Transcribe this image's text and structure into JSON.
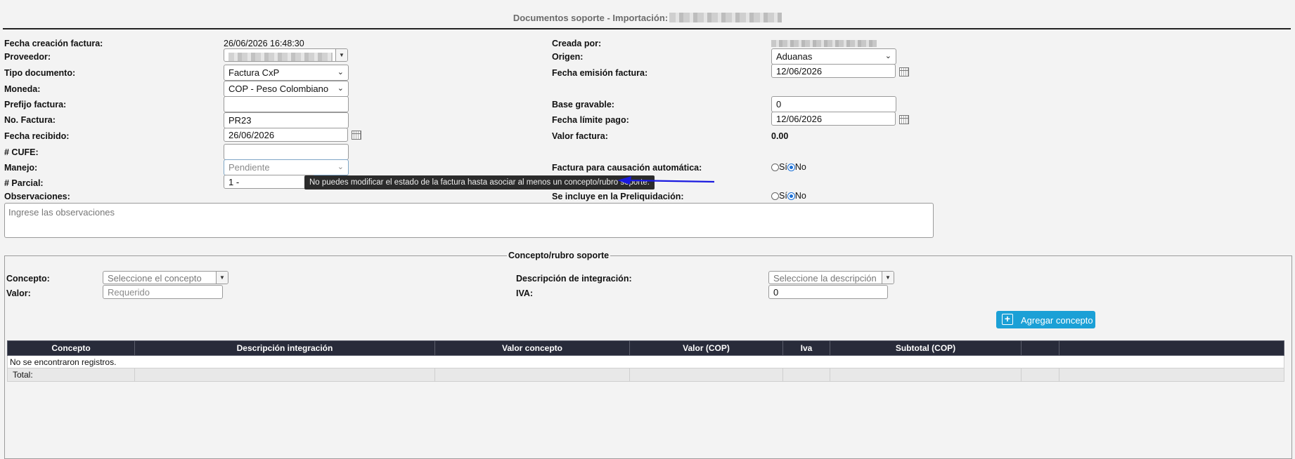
{
  "header": {
    "title": "Documentos soporte - Importación:"
  },
  "left": {
    "fecha_creacion": {
      "label": "Fecha creación factura:",
      "value": "26/06/2026 16:48:30"
    },
    "proveedor": {
      "label": "Proveedor:"
    },
    "tipo_documento": {
      "label": "Tipo documento:",
      "value": "Factura CxP"
    },
    "moneda": {
      "label": "Moneda:",
      "value": "COP - Peso Colombiano"
    },
    "prefijo": {
      "label": "Prefijo factura:",
      "value": ""
    },
    "no_factura": {
      "label": "No. Factura:",
      "value": "PR23"
    },
    "fecha_recibido": {
      "label": "Fecha recibido:",
      "value": "26/06/2026"
    },
    "cufe": {
      "label": "# CUFE:",
      "value": ""
    },
    "manejo": {
      "label": "Manejo:",
      "value": "Pendiente"
    },
    "parcial": {
      "label": "# Parcial:",
      "value": "1 -"
    },
    "observaciones": {
      "label": "Observaciones:",
      "placeholder": "Ingrese las observaciones"
    }
  },
  "right": {
    "creada_por": {
      "label": "Creada por:"
    },
    "origen": {
      "label": "Origen:",
      "value": "Aduanas"
    },
    "fecha_emision": {
      "label": "Fecha emisión factura:",
      "value": "12/06/2026"
    },
    "base_gravable": {
      "label": "Base gravable:",
      "value": "0"
    },
    "fecha_limite": {
      "label": "Fecha límite pago:",
      "value": "12/06/2026"
    },
    "valor_factura": {
      "label": "Valor factura:",
      "value": "0.00"
    },
    "causacion": {
      "label": "Factura para causación automática:",
      "opt_si": "Sí",
      "opt_no": "No",
      "selected": "No"
    },
    "preliquidacion": {
      "label": "Se incluye en la Preliquidación:",
      "opt_si": "Sí",
      "opt_no": "No",
      "selected": "No"
    }
  },
  "tooltip": {
    "text": "No puedes modificar el estado de la factura hasta asociar al menos un concepto/rubro soporte."
  },
  "arrow_color": "#1a1ae0",
  "concepto_section": {
    "legend": "Concepto/rubro soporte",
    "concepto": {
      "label": "Concepto:",
      "placeholder": "Seleccione el concepto"
    },
    "valor": {
      "label": "Valor:",
      "placeholder": "Requerido"
    },
    "descripcion": {
      "label": "Descripción de integración:",
      "placeholder": "Seleccione la descripción"
    },
    "iva": {
      "label": "IVA:",
      "value": "0"
    },
    "add_button": "Agregar concepto",
    "add_button_color": "#1ba0d6"
  },
  "table": {
    "headers": [
      "Concepto",
      "Descripción integración",
      "Valor concepto",
      "Valor (COP)",
      "Iva",
      "Subtotal (COP)",
      "",
      ""
    ],
    "empty_message": "No se encontraron registros.",
    "total_label": "Total:"
  }
}
